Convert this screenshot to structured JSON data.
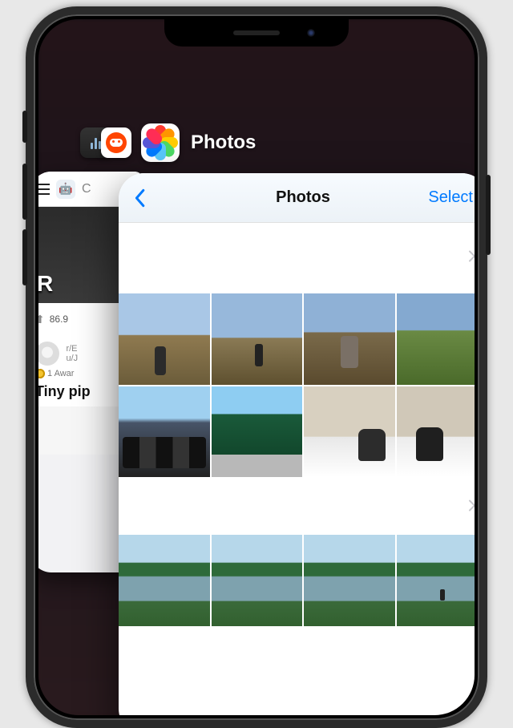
{
  "switcher": {
    "foreground_app": {
      "name": "Photos",
      "icon": "photos-app-icon"
    },
    "background_app_icons": [
      "stocks-icon",
      "reddit-icon"
    ]
  },
  "photos_card": {
    "nav": {
      "back_icon": "chevron-left-icon",
      "title": "Photos",
      "select_label": "Select"
    },
    "section_chevron": "chevron-right-icon"
  },
  "reddit_card": {
    "search_letter": "C",
    "hero_letter": "R",
    "upvote_count": "86.9",
    "post_sub": "r/E",
    "post_user": "u/J",
    "award_label": "1 Awar",
    "post_title": "Tiny pip"
  }
}
